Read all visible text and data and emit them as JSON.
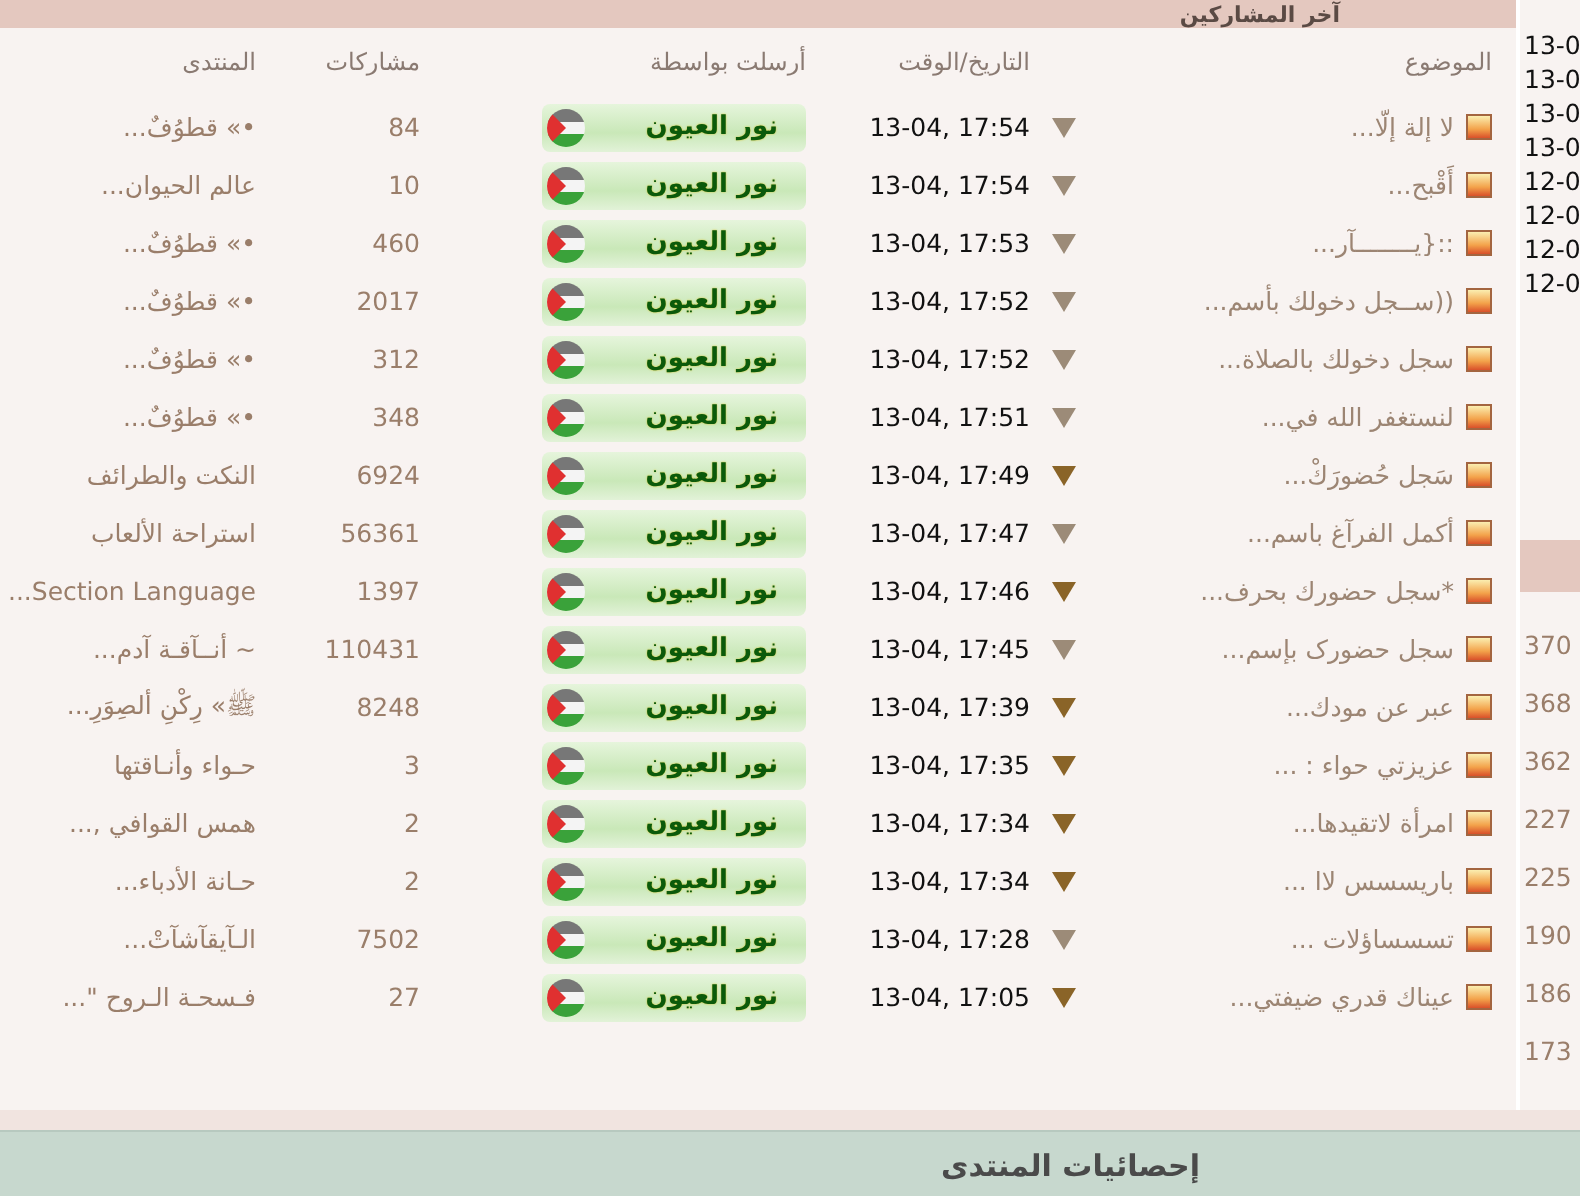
{
  "section_title": "آخر المشاركين",
  "table": {
    "columns": [
      "الموضوع",
      "التاريخ/الوقت",
      "أرسلت بواسطة",
      "مشاركات",
      "المنتدى"
    ],
    "rows": [
      {
        "topic": "لا إلة إلّا...",
        "date": "13-04, 17:54",
        "highlighted": false,
        "sender": "نور العيون",
        "posts": "84",
        "forum": "•» قطوُفٌ..."
      },
      {
        "topic": "أَقْبح...",
        "date": "13-04, 17:54",
        "highlighted": false,
        "sender": "نور العيون",
        "posts": "10",
        "forum": "عالم الحيوان..."
      },
      {
        "topic": "::{يــــــــآر...",
        "date": "13-04, 17:53",
        "highlighted": false,
        "sender": "نور العيون",
        "posts": "460",
        "forum": "•» قطوُفٌ..."
      },
      {
        "topic": "((ســجل دخولك بأسم...",
        "date": "13-04, 17:52",
        "highlighted": false,
        "sender": "نور العيون",
        "posts": "2017",
        "forum": "•» قطوُفٌ..."
      },
      {
        "topic": "سجل دخولك بالصلاة...",
        "date": "13-04, 17:52",
        "highlighted": false,
        "sender": "نور العيون",
        "posts": "312",
        "forum": "•» قطوُفٌ..."
      },
      {
        "topic": "لنستغفر الله في...",
        "date": "13-04, 17:51",
        "highlighted": false,
        "sender": "نور العيون",
        "posts": "348",
        "forum": "•» قطوُفٌ..."
      },
      {
        "topic": "سَجل حُضورَكْ...",
        "date": "13-04, 17:49",
        "highlighted": true,
        "sender": "نور العيون",
        "posts": "6924",
        "forum": "النكت والطرائف"
      },
      {
        "topic": "أكمل الفرآغ باسم...",
        "date": "13-04, 17:47",
        "highlighted": false,
        "sender": "نور العيون",
        "posts": "56361",
        "forum": "استراحة الألعاب"
      },
      {
        "topic": "*سجل حضورك بحرف...",
        "date": "13-04, 17:46",
        "highlighted": true,
        "sender": "نور العيون",
        "posts": "1397",
        "forum": "Section Language..."
      },
      {
        "topic": "سجل حضورک بإسم...",
        "date": "13-04, 17:45",
        "highlighted": false,
        "sender": "نور العيون",
        "posts": "110431",
        "forum": "~ أنــآقـة آدم..."
      },
      {
        "topic": "عبر عن مودك...",
        "date": "13-04, 17:39",
        "highlighted": true,
        "sender": "نور العيون",
        "posts": "8248",
        "forum": "ﷺ» رِكْنِ ألصِوَرِ..."
      },
      {
        "topic": "عزيزتي حواء : ...",
        "date": "13-04, 17:35",
        "highlighted": true,
        "sender": "نور العيون",
        "posts": "3",
        "forum": "حـواء وأنـاقتها"
      },
      {
        "topic": "امرأة لاتقيدها...",
        "date": "13-04, 17:34",
        "highlighted": true,
        "sender": "نور العيون",
        "posts": "2",
        "forum": "همس القوافي ,..."
      },
      {
        "topic": "باريسسس لاا ...",
        "date": "13-04, 17:34",
        "highlighted": true,
        "sender": "نور العيون",
        "posts": "2",
        "forum": "حـانة الأدباء..."
      },
      {
        "topic": "تسسساؤلات ...",
        "date": "13-04, 17:28",
        "highlighted": false,
        "sender": "نور العيون",
        "posts": "7502",
        "forum": "الـآيقآشآتْ..."
      },
      {
        "topic": "عيناك قدري ضيفتي...",
        "date": "13-04, 17:05",
        "highlighted": true,
        "sender": "نور العيون",
        "posts": "27",
        "forum": "فـسحـة الـروح \"..."
      }
    ]
  },
  "side": {
    "dates": [
      "13-0",
      "13-0",
      "13-0",
      "13-0",
      "12-0",
      "12-0",
      "12-0",
      "12-0"
    ],
    "counts": [
      "370",
      "368",
      "362",
      "227",
      "225",
      "190",
      "186",
      "173"
    ]
  },
  "stats_title": "إحصائيات المنتدى"
}
